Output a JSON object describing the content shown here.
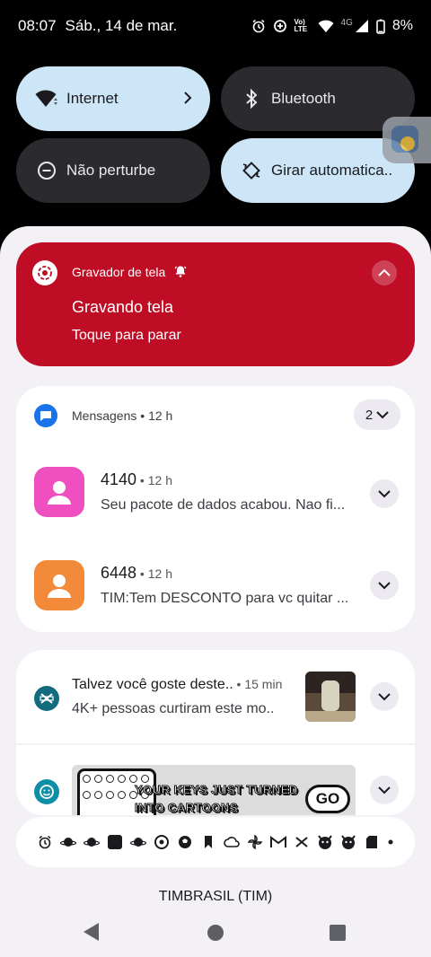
{
  "status_bar": {
    "time": "08:07",
    "date": "Sáb., 14 de mar.",
    "icons": [
      "alarm-icon",
      "data-saver-icon",
      "volte-icon",
      "wifi-icon",
      "signal-icon",
      "battery-icon"
    ],
    "volte_label": "Vo) LTE",
    "network_label": "4G",
    "battery": "8%"
  },
  "quick_settings": {
    "internet": {
      "label": "Internet",
      "state": "on"
    },
    "bluetooth": {
      "label": "Bluetooth",
      "state": "off"
    },
    "dnd": {
      "label": "Não perturbe",
      "state": "off"
    },
    "rotate": {
      "label": "Girar automatica..",
      "state": "on"
    }
  },
  "notifications": {
    "screen_recorder": {
      "app_name": "Gravador de tela",
      "title": "Gravando tela",
      "text": "Toque para parar",
      "color": "#c00d26"
    },
    "messages_group": {
      "app_name": "Mensagens",
      "time": " • 12 h",
      "count": "2",
      "items": [
        {
          "sender": "4140",
          "time": " • 12 h",
          "preview": "Seu pacote de dados acabou. Nao fi...",
          "avatar_color": "#ef4fbf"
        },
        {
          "sender": "6448",
          "time": " • 12 h",
          "preview": "TIM:Tem DESCONTO para vc quitar ...",
          "avatar_color": "#f28a3a"
        }
      ]
    },
    "suggestion": {
      "title": "Talvez você goste deste..",
      "time": " • 15 min",
      "text": "4K+ pessoas curtiram este mo.."
    },
    "gboard": {
      "banner_line1": "YOUR KEYS JUST TURNED",
      "banner_line2": "INTO CARTOONS",
      "banner_button": "GO"
    }
  },
  "tray_icons": [
    "alarm-icon",
    "planet-icon",
    "planet-icon",
    "square-app-icon",
    "planet-icon",
    "chrome-icon",
    "soccer-icon",
    "bookmark-icon",
    "cloud-icon",
    "pinwheel-icon",
    "gmail-icon",
    "capcut-icon",
    "devil-icon",
    "devil-icon",
    "sd-card-icon",
    "more-dot-icon"
  ],
  "carrier": "TIMBRASIL (TIM)"
}
